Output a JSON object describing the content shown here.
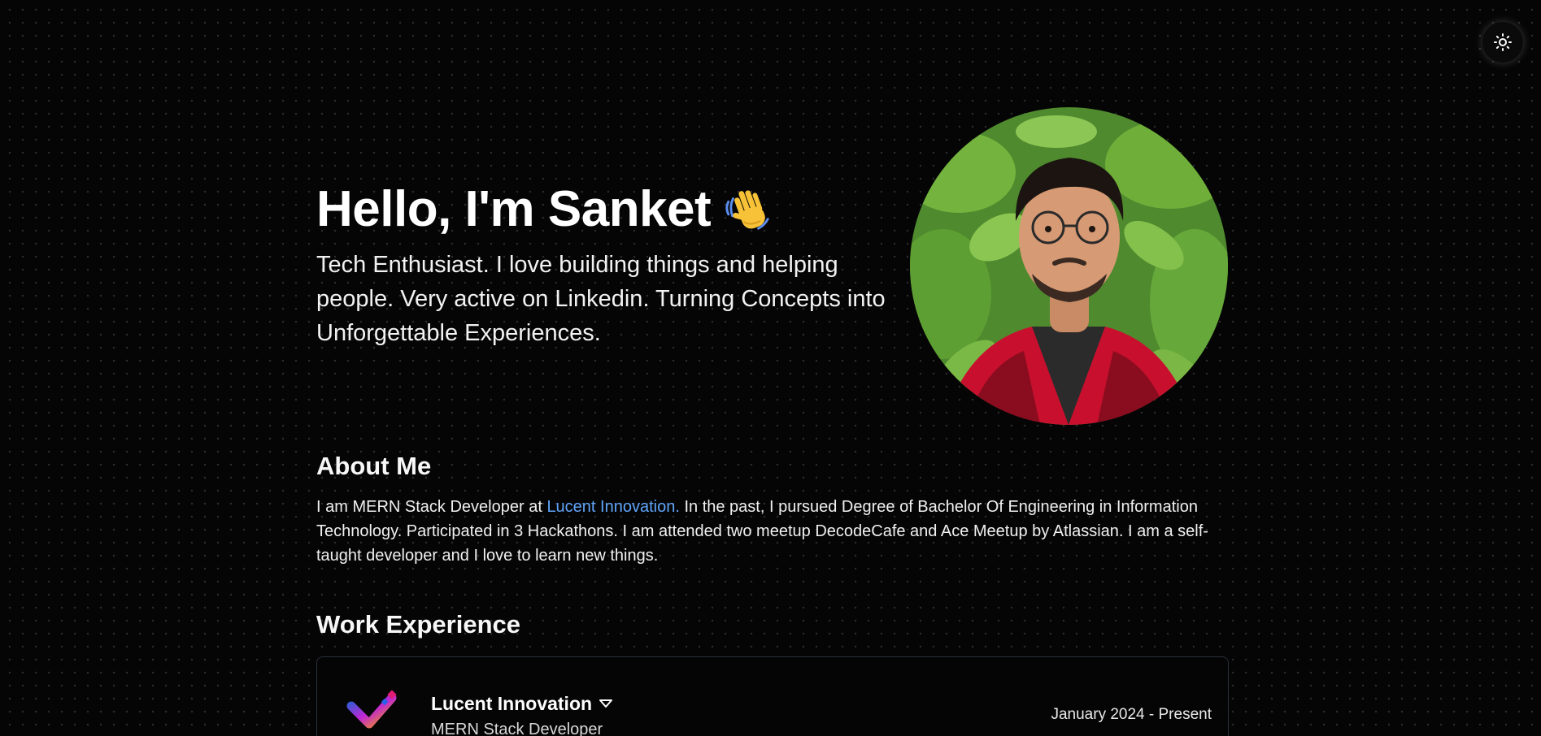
{
  "theme_toggle": {
    "icon": "sun-icon",
    "aria": "Toggle theme"
  },
  "hero": {
    "title": "Hello, I'm Sanket",
    "emoji": "waving-hand-icon",
    "subtitle": "Tech Enthusiast. I love building things and helping people. Very active on Linkedin. Turning Concepts into Unforgettable Experiences."
  },
  "about": {
    "heading": "About Me",
    "text_before": "I am MERN Stack Developer at ",
    "link_text": "Lucent Innovation.",
    "text_after": " In the past, I pursued Degree of Bachelor Of Engineering in Information Technology. Participated in 3 Hackathons. I am attended two meetup DecodeCafe and Ace Meetup by Atlassian. I am a self-taught developer and I love to learn new things."
  },
  "work": {
    "heading": "Work Experience",
    "items": [
      {
        "company": "Lucent Innovation",
        "role": "MERN Stack Developer",
        "dates": "January 2024 - Present"
      }
    ]
  },
  "colors": {
    "background": "#050505",
    "link": "#60a5fa",
    "card_border": "#2a2f3a"
  }
}
